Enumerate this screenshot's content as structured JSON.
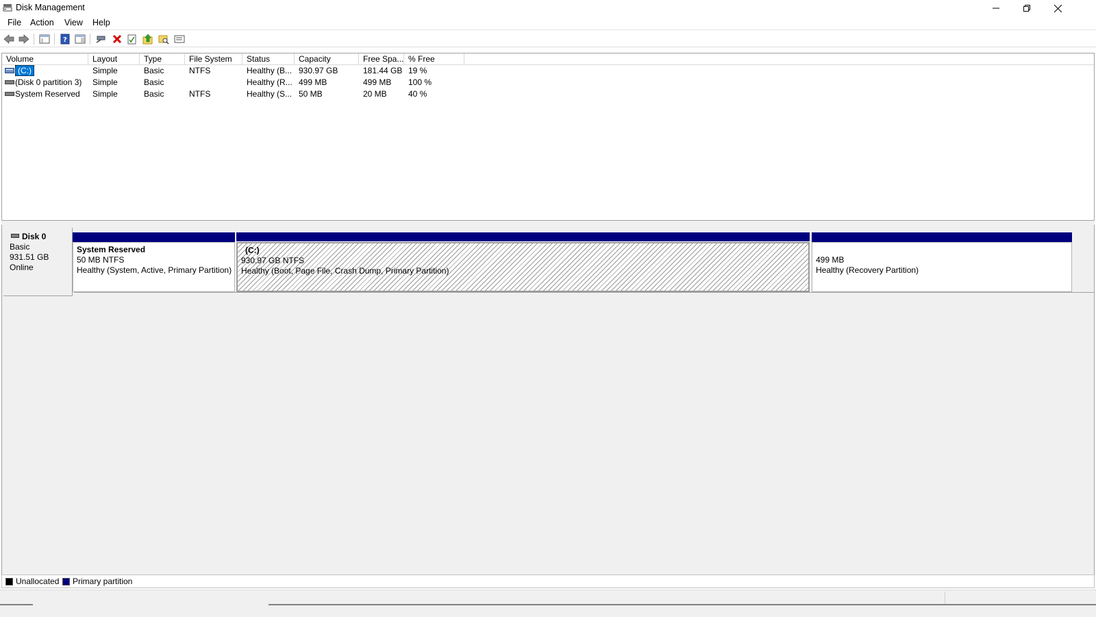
{
  "window": {
    "title": "Disk Management",
    "icon": "disk-management-icon"
  },
  "menu": [
    {
      "label": "File"
    },
    {
      "label": "Action"
    },
    {
      "label": "View"
    },
    {
      "label": "Help"
    }
  ],
  "toolbar": {
    "icons": [
      "back-arrow-icon",
      "forward-arrow-icon",
      "show-hide-console-tree-icon",
      "help-icon",
      "properties-pane-icon",
      "connect-disk-icon",
      "delete-icon",
      "properties-check-icon",
      "folder-up-icon",
      "folder-search-icon",
      "view-settings-icon"
    ]
  },
  "volume_table": {
    "columns": [
      "Volume",
      "Layout",
      "Type",
      "File System",
      "Status",
      "Capacity",
      "Free Spa...",
      "% Free"
    ],
    "rows": [
      {
        "volume": "(C:)",
        "layout": "Simple",
        "type": "Basic",
        "fs": "NTFS",
        "status": "Healthy (B...",
        "capacity": "930.97 GB",
        "free": "181.44 GB",
        "pct": "19 %",
        "selected": true
      },
      {
        "volume": "(Disk 0 partition 3)",
        "layout": "Simple",
        "type": "Basic",
        "fs": "",
        "status": "Healthy (R...",
        "capacity": "499 MB",
        "free": "499 MB",
        "pct": "100 %",
        "selected": false
      },
      {
        "volume": "System Reserved",
        "layout": "Simple",
        "type": "Basic",
        "fs": "NTFS",
        "status": "Healthy (S...",
        "capacity": "50 MB",
        "free": "20 MB",
        "pct": "40 %",
        "selected": false
      }
    ]
  },
  "disk": {
    "name": "Disk 0",
    "type": "Basic",
    "size": "931.51 GB",
    "state": "Online",
    "partitions": [
      {
        "title": "System Reserved",
        "size": "50 MB NTFS",
        "status": "Healthy (System, Active, Primary Partition)"
      },
      {
        "title": "(C:)",
        "size": "930.97 GB NTFS",
        "status": "Healthy (Boot, Page File, Crash Dump, Primary Partition)"
      },
      {
        "title": "",
        "size": "499 MB",
        "status": "Healthy (Recovery Partition)"
      }
    ]
  },
  "legend": {
    "unallocated": {
      "label": "Unallocated",
      "color": "#000000"
    },
    "primary": {
      "label": "Primary partition",
      "color": "#00007f"
    }
  }
}
